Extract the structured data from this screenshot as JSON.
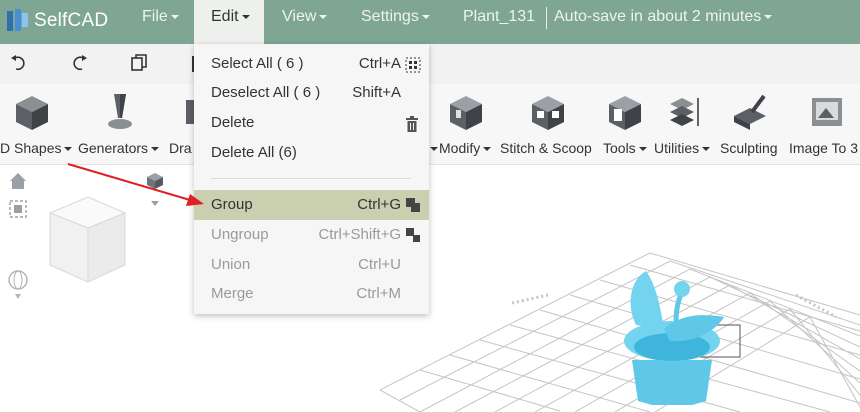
{
  "app": {
    "logo_text": "SelfCAD"
  },
  "menu": {
    "file": "File",
    "edit": "Edit",
    "view": "View",
    "settings": "Settings",
    "project_name": "Plant_131",
    "autosave": "Auto-save in about 2 minutes"
  },
  "tools": [
    {
      "label": "D Shapes"
    },
    {
      "label": "Generators"
    },
    {
      "label": "Dra"
    },
    {
      "label": "Modify"
    },
    {
      "label": "Stitch & Scoop"
    },
    {
      "label": "Tools"
    },
    {
      "label": "Utilities"
    },
    {
      "label": "Sculpting"
    },
    {
      "label": "Image To 3"
    }
  ],
  "edit_menu": {
    "select_all": {
      "label": "Select All   ( 6 )",
      "shortcut": "Ctrl+A"
    },
    "deselect_all": {
      "label": "Deselect All   ( 6 )",
      "shortcut": "Shift+A"
    },
    "delete": {
      "label": "Delete"
    },
    "delete_all": {
      "label": "Delete All (6)"
    },
    "group": {
      "label": "Group",
      "shortcut": "Ctrl+G"
    },
    "ungroup": {
      "label": "Ungroup",
      "shortcut": "Ctrl+Shift+G"
    },
    "union": {
      "label": "Union",
      "shortcut": "Ctrl+U"
    },
    "merge": {
      "label": "Merge",
      "shortcut": "Ctrl+M"
    }
  },
  "colors": {
    "menubar": "#7fa693",
    "highlight": "#c9cfaf",
    "model": "#5fc8e8",
    "annotation_arrow": "#e02020"
  }
}
